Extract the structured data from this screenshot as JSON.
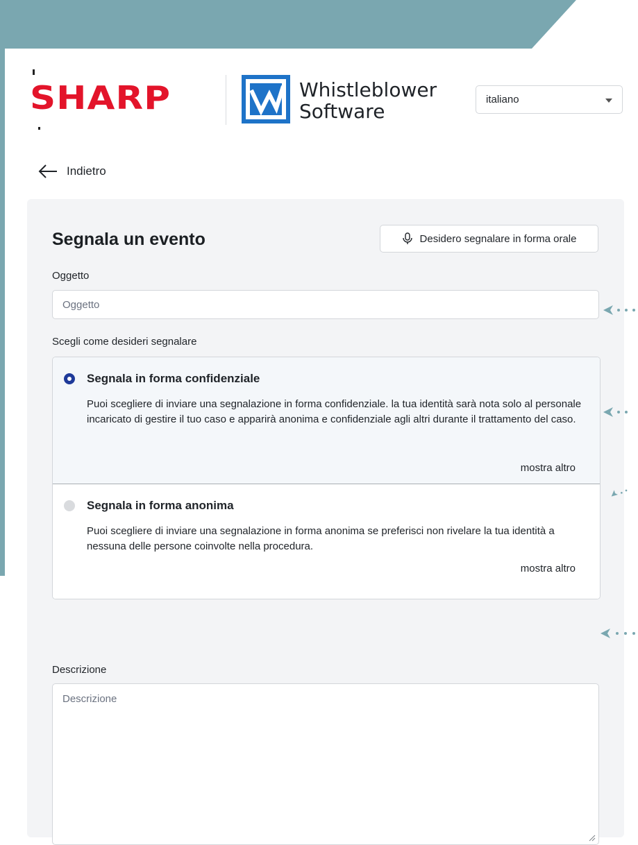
{
  "brand": {
    "company_logo": "SHARP",
    "product_line1": "Whistleblower",
    "product_line2": "Software",
    "colors": {
      "sharp_red": "#e3142a",
      "banner_teal": "#7aa7b0",
      "wb_blue": "#1e73c8"
    }
  },
  "language": {
    "selected": "italiano"
  },
  "nav": {
    "back_label": "Indietro"
  },
  "form": {
    "title": "Segnala un evento",
    "oral_button_label": "Desidero segnalare in forma orale",
    "subject": {
      "label": "Oggetto",
      "placeholder": "Oggetto"
    },
    "report_mode": {
      "label": "Scegli come desideri segnalare",
      "options": [
        {
          "title": "Segnala in forma confidenziale",
          "description": " Puoi scegliere di inviare una segnalazione in forma confidenziale. la tua identità sarà nota solo al personale incaricato di gestire il tuo caso e apparirà anonima e confidenziale agli altri durante il trattamento del caso.",
          "more_label": "mostra altro",
          "selected": true
        },
        {
          "title": "Segnala in forma anonima",
          "description": " Puoi scegliere di inviare una segnalazione in forma anonima se preferisci non rivelare la tua identità a nessuna delle persone coinvolte nella procedura.",
          "more_label": "mostra altro",
          "selected": false
        }
      ]
    },
    "description": {
      "label": "Descrizione",
      "placeholder": "Descrizione"
    }
  },
  "icons": [
    "arrow-left-icon",
    "microphone-icon",
    "chevron-down-icon",
    "resize-handle-icon",
    "whistleblower-logo-icon"
  ]
}
